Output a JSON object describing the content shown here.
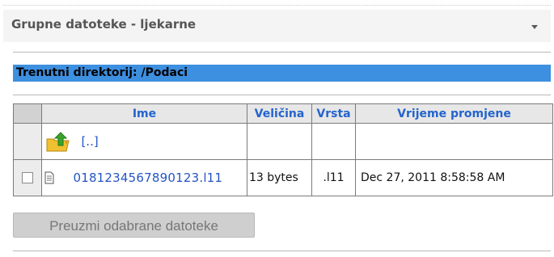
{
  "panel": {
    "title": "Grupne datoteke - ljekarne"
  },
  "current_dir": {
    "label": "Trenutni direktorij: /Podaci"
  },
  "table": {
    "headers": {
      "name": "Ime",
      "size": "Veličina",
      "type": "Vrsta",
      "modified": "Vrijeme promjene"
    },
    "parent_link": "[..]",
    "rows": [
      {
        "name": "0181234567890123.l11",
        "size": "13 bytes",
        "type": ".l11",
        "modified": "Dec 27, 2011 8:58:58 AM"
      }
    ]
  },
  "actions": {
    "download_label": "Preuzmi odabrane datoteke"
  },
  "icons": {
    "collapse": "chevron-down-icon",
    "parent_folder": "folder-up-icon",
    "file": "document-icon"
  },
  "colors": {
    "link": "#2454c5",
    "header_text": "#2464ce",
    "current_dir_bg": "#3d8fe0",
    "folder": "#f0c030",
    "up_arrow": "#3aa32a"
  }
}
